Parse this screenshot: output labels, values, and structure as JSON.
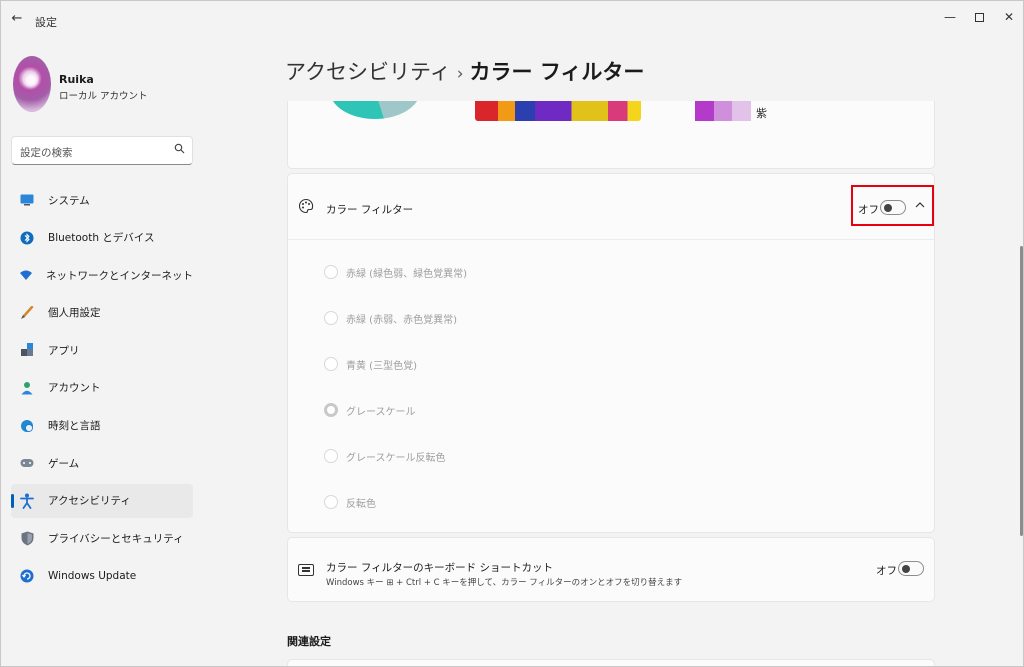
{
  "window": {
    "title": "設定",
    "back_icon": "←",
    "minimize_icon": "—",
    "close_icon": "✕"
  },
  "user": {
    "name": "Ruika",
    "account_type": "ローカル アカウント"
  },
  "search": {
    "placeholder": "設定の検索"
  },
  "sidebar": {
    "items": [
      {
        "label": "システム",
        "icon": "system-icon",
        "color": "#0f6cbd"
      },
      {
        "label": "Bluetooth とデバイス",
        "icon": "bluetooth-icon",
        "color": "#0f6cbd"
      },
      {
        "label": "ネットワークとインターネット",
        "icon": "network-icon",
        "color": "#1f6fd0"
      },
      {
        "label": "個人用設定",
        "icon": "brush-icon",
        "color": "#d08a2c"
      },
      {
        "label": "アプリ",
        "icon": "apps-icon",
        "color": "#4a5563"
      },
      {
        "label": "アカウント",
        "icon": "person-icon",
        "color": "#2ea26a"
      },
      {
        "label": "時刻と言語",
        "icon": "clock-globe-icon",
        "color": "#1f8ad0"
      },
      {
        "label": "ゲーム",
        "icon": "gamepad-icon",
        "color": "#7a8794"
      },
      {
        "label": "アクセシビリティ",
        "icon": "accessibility-icon",
        "color": "#1f6fd0",
        "active": true
      },
      {
        "label": "プライバシーとセキュリティ",
        "icon": "shield-icon",
        "color": "#6b7480"
      },
      {
        "label": "Windows Update",
        "icon": "update-icon",
        "color": "#1f6fd0"
      }
    ]
  },
  "breadcrumb": {
    "parent": "アクセシビリティ",
    "separator": "›",
    "current": "カラー フィルター"
  },
  "preview": {
    "swatch_label": "紫",
    "swatch_colors": [
      "#b43ac9",
      "#cf8fda",
      "#e3c2ea"
    ]
  },
  "color_filter": {
    "title": "カラー フィルター",
    "state": "オフ",
    "toggle_on": false,
    "expand_icon": "⌃",
    "options": [
      {
        "label": "赤緑 (緑色弱、緑色覚異常)",
        "selected": false
      },
      {
        "label": "赤緑 (赤弱、赤色覚異常)",
        "selected": false
      },
      {
        "label": "青黄 (三型色覚)",
        "selected": false
      },
      {
        "label": "グレースケール",
        "selected": true
      },
      {
        "label": "グレースケール反転色",
        "selected": false
      },
      {
        "label": "反転色",
        "selected": false
      }
    ]
  },
  "shortcut": {
    "title": "カラー フィルターのキーボード ショートカット",
    "description": "Windows キー ⊞ + Ctrl + C キーを押して、カラー フィルターのオンとオフを切り替えます",
    "state": "オフ",
    "toggle_on": false
  },
  "related": {
    "title": "関連設定"
  },
  "colors": {
    "accent": "#005fb8",
    "highlight": "#e8000f"
  }
}
